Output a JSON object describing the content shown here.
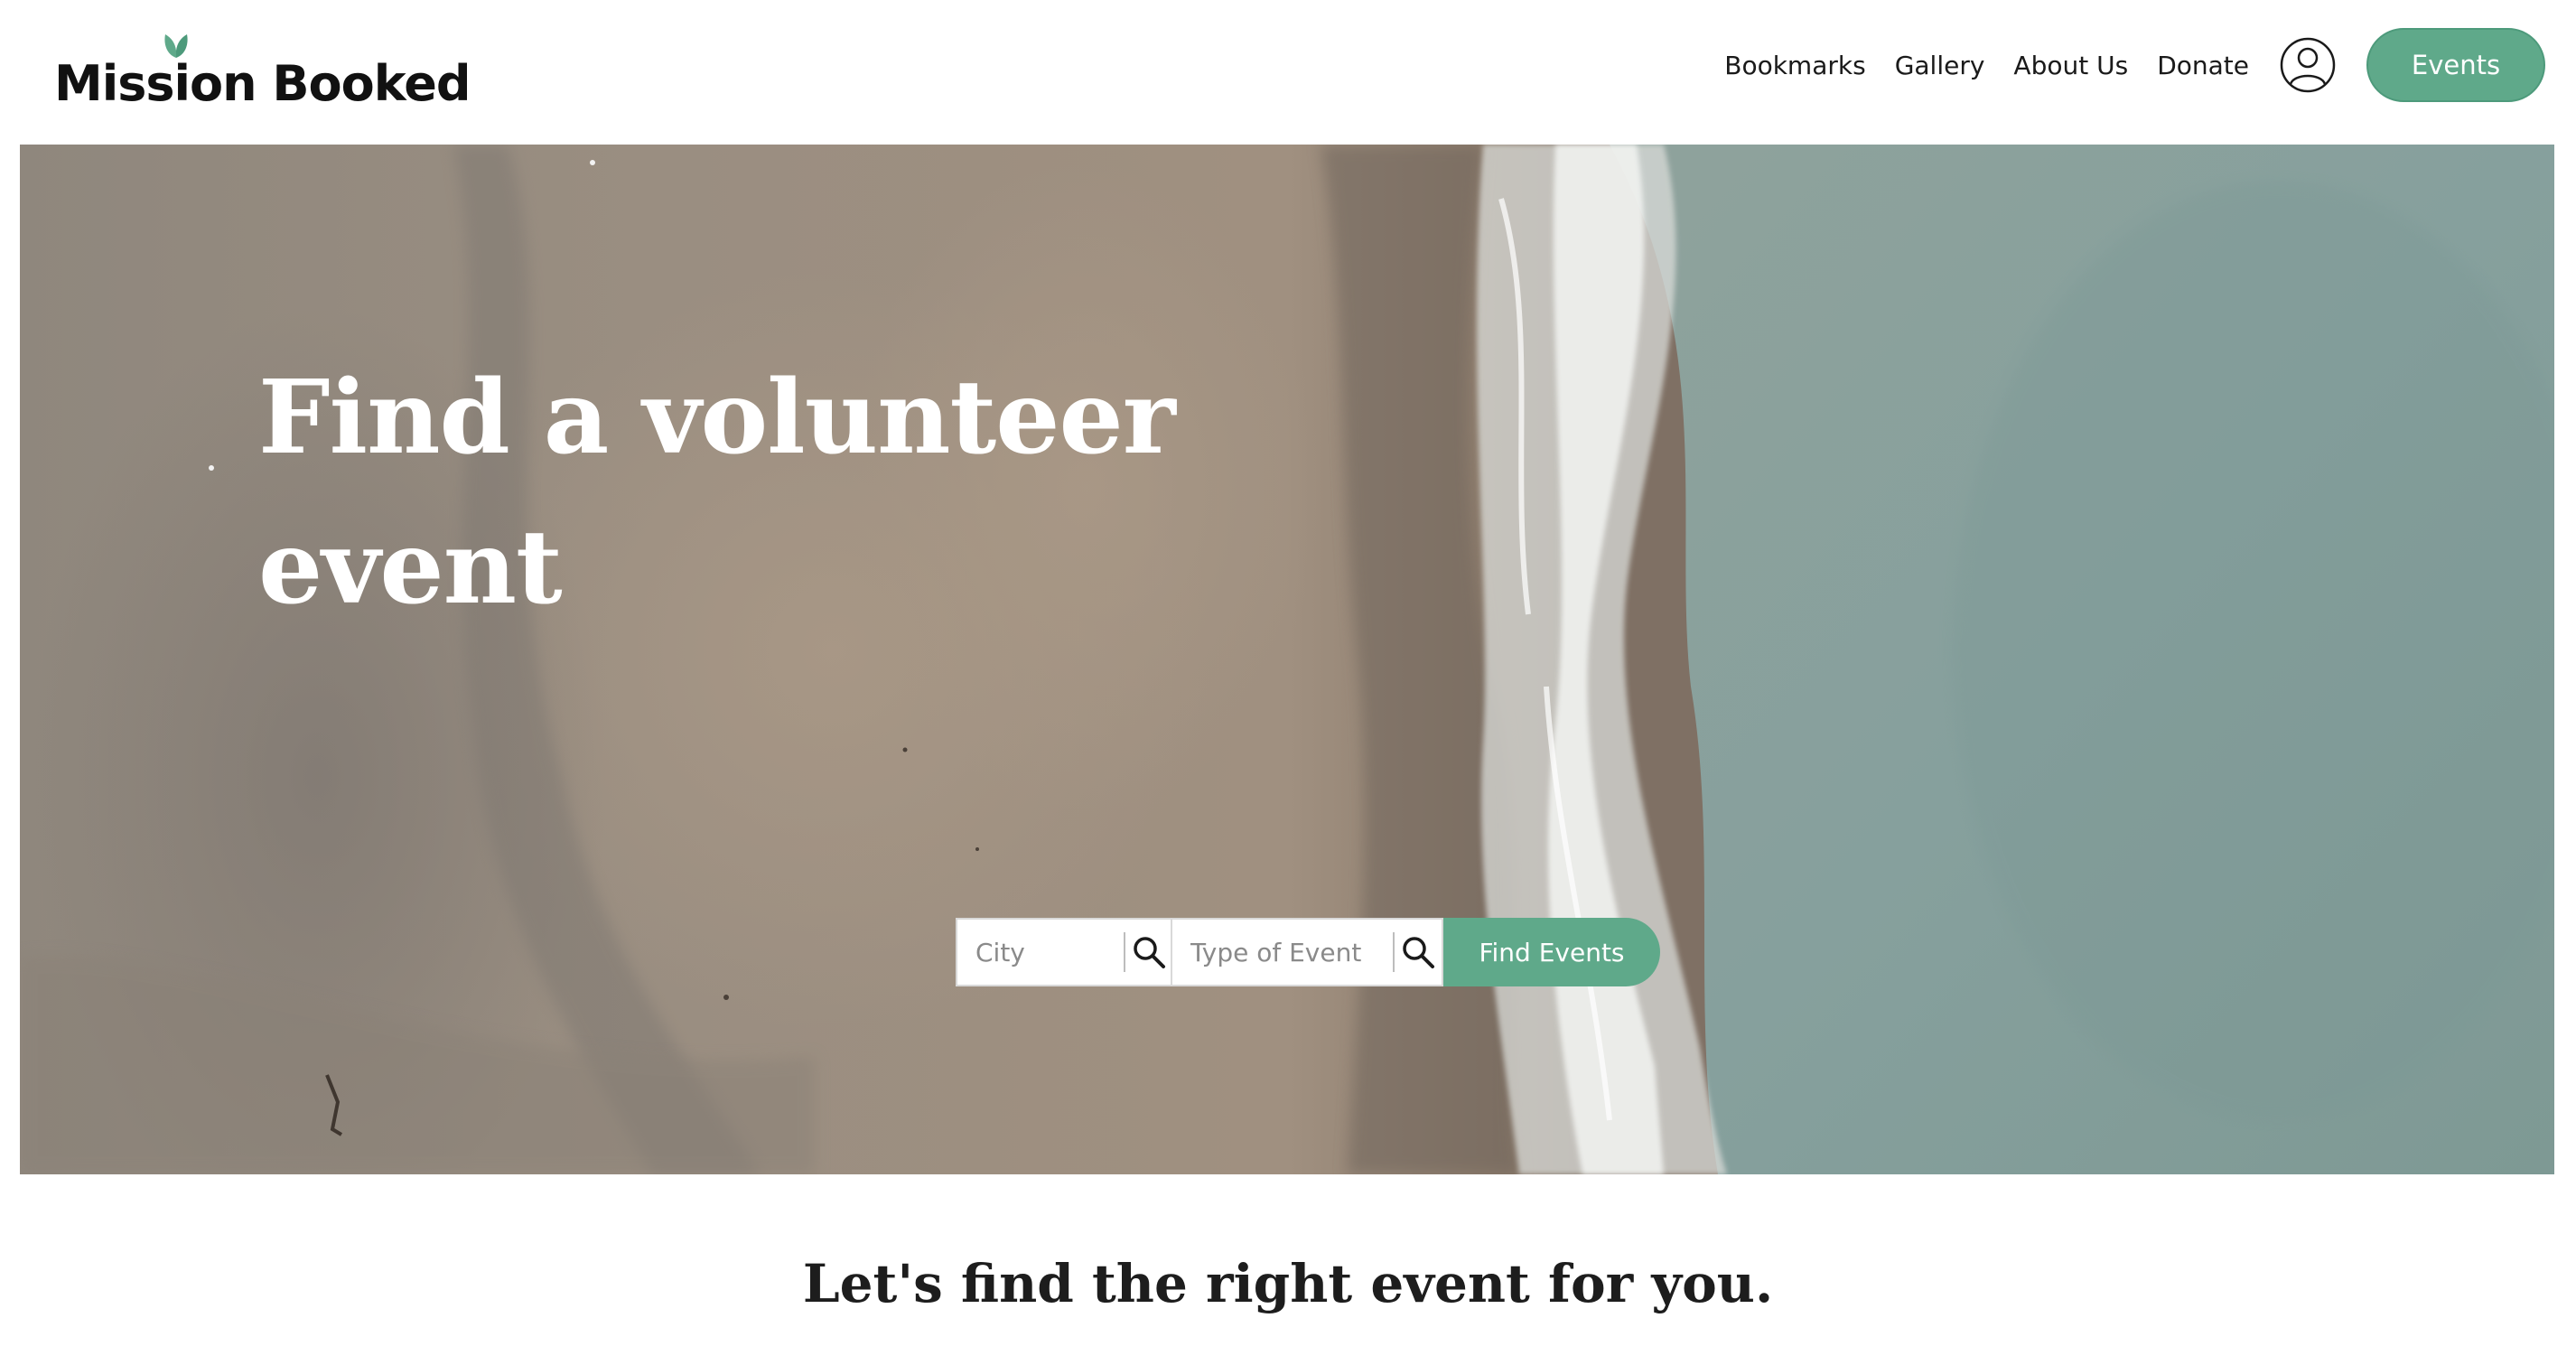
{
  "brand": {
    "name": "Mission Booked",
    "accent_color": "#5fa98a"
  },
  "nav": {
    "links": [
      "Bookmarks",
      "Gallery",
      "About Us",
      "Donate"
    ],
    "account_icon": "user-circle-icon",
    "events_label": "Events"
  },
  "hero": {
    "title": "Find a volunteer event",
    "background": "aerial beach shoreline photo"
  },
  "search": {
    "city_placeholder": "City",
    "type_placeholder": "Type of Event",
    "search_icon": "magnifier-icon",
    "submit_label": "Find Events"
  },
  "section": {
    "heading": "Let's find the right event for you."
  }
}
